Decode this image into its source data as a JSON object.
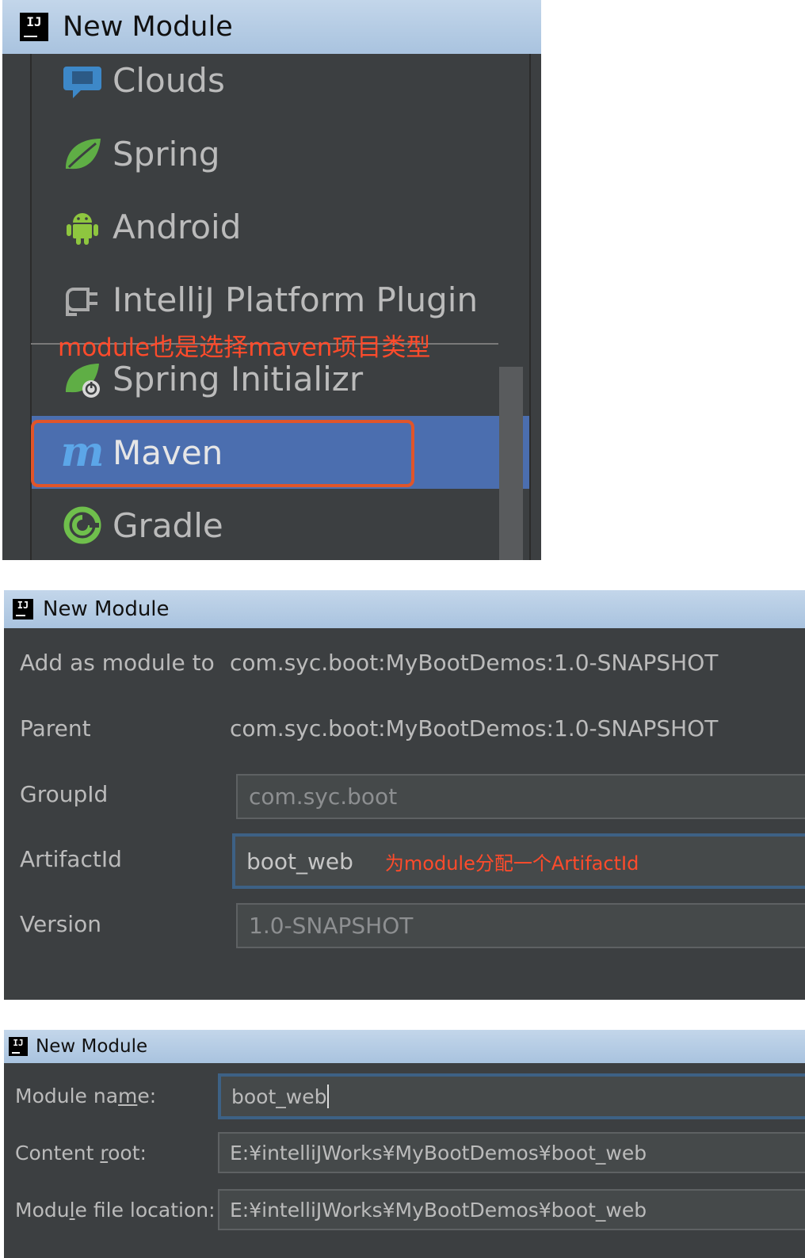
{
  "panel1": {
    "title": "New Module",
    "items": [
      {
        "label": "Clouds",
        "icon": "clouds-icon"
      },
      {
        "label": "Spring",
        "icon": "spring-leaf-icon"
      },
      {
        "label": "Android",
        "icon": "android-icon"
      },
      {
        "label": "IntelliJ Platform Plugin",
        "icon": "plugin-icon"
      },
      {
        "label": "Spring Initializr",
        "icon": "spring-initializr-icon"
      },
      {
        "label": "Maven",
        "icon": "maven-icon",
        "selected": true
      },
      {
        "label": "Gradle",
        "icon": "gradle-icon"
      }
    ],
    "annotation": "module也是选择maven项目类型",
    "colors": {
      "selected": "#4b6eaf",
      "annotation": "#ff4b2b"
    }
  },
  "panel2": {
    "title": "New Module",
    "add_as_module_label": "Add as module to",
    "add_as_module_value": "com.syc.boot:MyBootDemos:1.0-SNAPSHOT",
    "parent_label": "Parent",
    "parent_value": "com.syc.boot:MyBootDemos:1.0-SNAPSHOT",
    "groupid_label": "GroupId",
    "groupid_value": "com.syc.boot",
    "artifactid_label": "ArtifactId",
    "artifactid_value": "boot_web",
    "artifactid_annotation": "为module分配一个ArtifactId",
    "version_label": "Version",
    "version_value": "1.0-SNAPSHOT"
  },
  "panel3": {
    "title": "New Module",
    "module_name_label_pre": "Module na",
    "module_name_label_u": "m",
    "module_name_label_post": "e:",
    "module_name_value": "boot_web",
    "content_root_label_pre": "Content ",
    "content_root_label_u": "r",
    "content_root_label_post": "oot:",
    "content_root_value": "E:¥intelliJWorks¥MyBootDemos¥boot_web",
    "file_location_label_pre": "Modu",
    "file_location_label_u": "l",
    "file_location_label_post": "e file location:",
    "file_location_value": "E:¥intelliJWorks¥MyBootDemos¥boot_web"
  }
}
